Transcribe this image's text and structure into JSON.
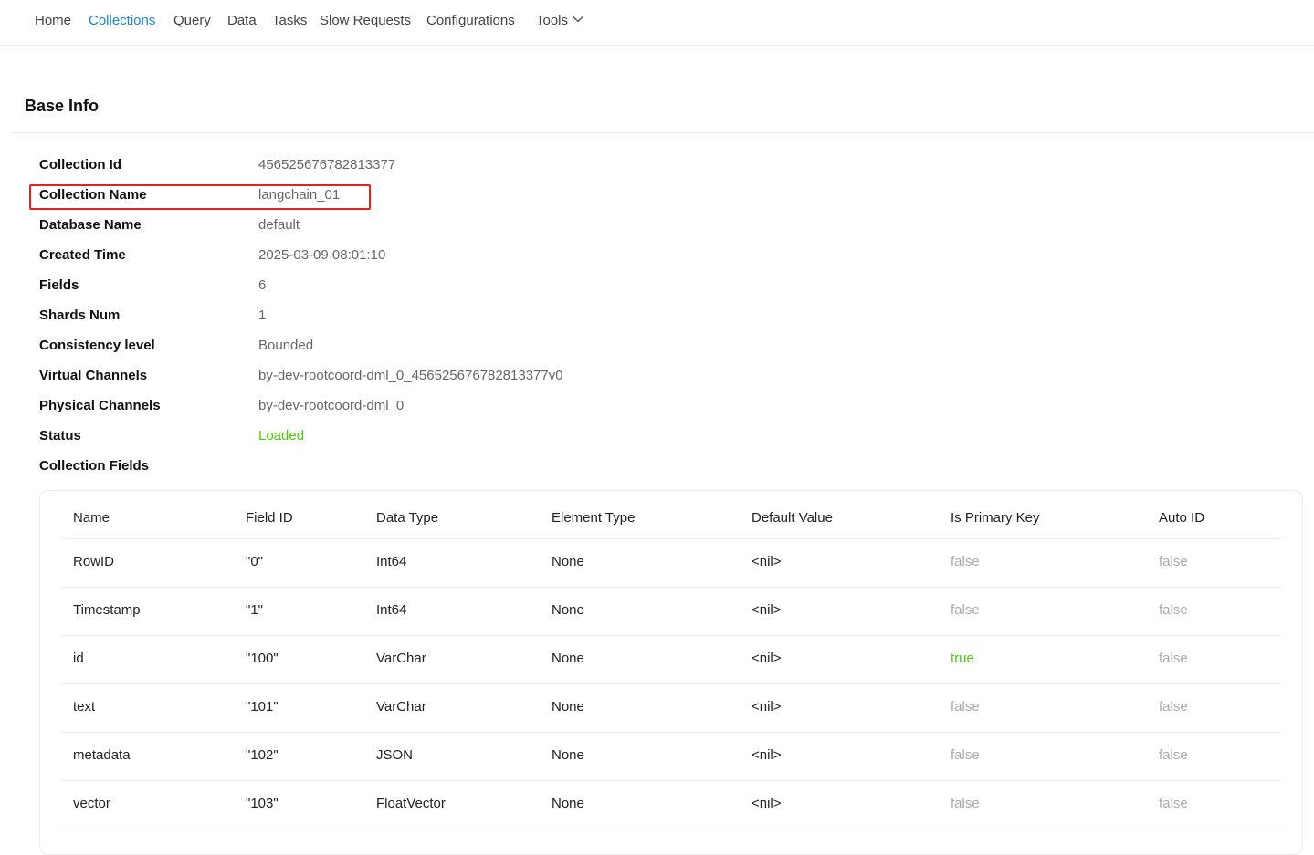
{
  "nav": {
    "items": [
      {
        "label": "Home",
        "active": false
      },
      {
        "label": "Collections",
        "active": true
      },
      {
        "label": "Query",
        "active": false
      },
      {
        "label": "Data",
        "active": false
      },
      {
        "label": "Tasks",
        "active": false
      },
      {
        "label": "Slow Requests",
        "active": false
      },
      {
        "label": "Configurations",
        "active": false
      },
      {
        "label": "Tools",
        "active": false,
        "icon": "chevron-down-icon"
      }
    ]
  },
  "base_info": {
    "title": "Base Info",
    "rows": [
      {
        "label": "Collection Id",
        "value": "456525676782813377"
      },
      {
        "label": "Collection Name",
        "value": "langchain_01"
      },
      {
        "label": "Database Name",
        "value": "default"
      },
      {
        "label": "Created Time",
        "value": "2025-03-09 08:01:10"
      },
      {
        "label": "Fields",
        "value": "6"
      },
      {
        "label": "Shards Num",
        "value": "1"
      },
      {
        "label": "Consistency level",
        "value": "Bounded"
      },
      {
        "label": "Virtual Channels",
        "value": "by-dev-rootcoord-dml_0_456525676782813377v0"
      },
      {
        "label": "Physical Channels",
        "value": "by-dev-rootcoord-dml_0"
      },
      {
        "label": "Status",
        "value": "Loaded"
      },
      {
        "label": "Collection Fields",
        "value": ""
      }
    ]
  },
  "fields_table": {
    "headers": [
      "Name",
      "Field ID",
      "Data Type",
      "Element Type",
      "Default Value",
      "Is Primary Key",
      "Auto ID"
    ],
    "rows": [
      [
        "RowID",
        "\"0\"",
        "Int64",
        "None",
        "<nil>",
        "false",
        "false"
      ],
      [
        "Timestamp",
        "\"1\"",
        "Int64",
        "None",
        "<nil>",
        "false",
        "false"
      ],
      [
        "id",
        "\"100\"",
        "VarChar",
        "None",
        "<nil>",
        "true",
        "false"
      ],
      [
        "text",
        "\"101\"",
        "VarChar",
        "None",
        "<nil>",
        "false",
        "false"
      ],
      [
        "metadata",
        "\"102\"",
        "JSON",
        "None",
        "<nil>",
        "false",
        "false"
      ],
      [
        "vector",
        "\"103\"",
        "FloatVector",
        "None",
        "<nil>",
        "false",
        "false"
      ]
    ]
  },
  "colors": {
    "accent": "#1e86c8",
    "status_ok": "#52c41a",
    "highlight": "#e02424",
    "muted": "#aaaaaa"
  }
}
